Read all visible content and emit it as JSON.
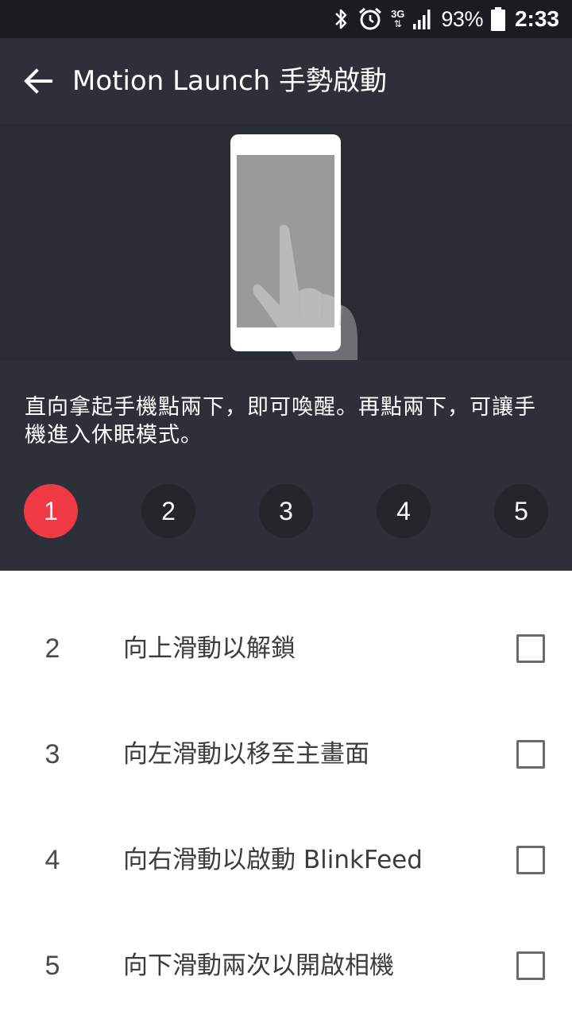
{
  "status_bar": {
    "network": "3G",
    "battery_pct": "93%",
    "time": "2:33"
  },
  "app_bar": {
    "title": "Motion Launch 手勢啟動"
  },
  "description": "直向拿起手機點兩下，即可喚醒。再點兩下，可讓手機進入休眠模式。",
  "steps": [
    {
      "label": "1",
      "active": true
    },
    {
      "label": "2",
      "active": false
    },
    {
      "label": "3",
      "active": false
    },
    {
      "label": "4",
      "active": false
    },
    {
      "label": "5",
      "active": false
    }
  ],
  "list": [
    {
      "num": "2",
      "label": "向上滑動以解鎖",
      "checked": false
    },
    {
      "num": "3",
      "label": "向左滑動以移至主畫面",
      "checked": false
    },
    {
      "num": "4",
      "label": "向右滑動以啟動 BlinkFeed",
      "checked": false
    },
    {
      "num": "5",
      "label": "向下滑動兩次以開啟相機",
      "checked": false
    }
  ],
  "colors": {
    "accent": "#ef3a45",
    "header_bg": "#2d3039",
    "illustration_bg": "#2a2c33",
    "status_bar_bg": "#1b1c20"
  },
  "icons": [
    "bluetooth-icon",
    "alarm-clock-icon",
    "network-3g-icon",
    "signal-icon",
    "battery-icon",
    "back-arrow-icon",
    "phone-illustration",
    "hand-tap-icon"
  ]
}
